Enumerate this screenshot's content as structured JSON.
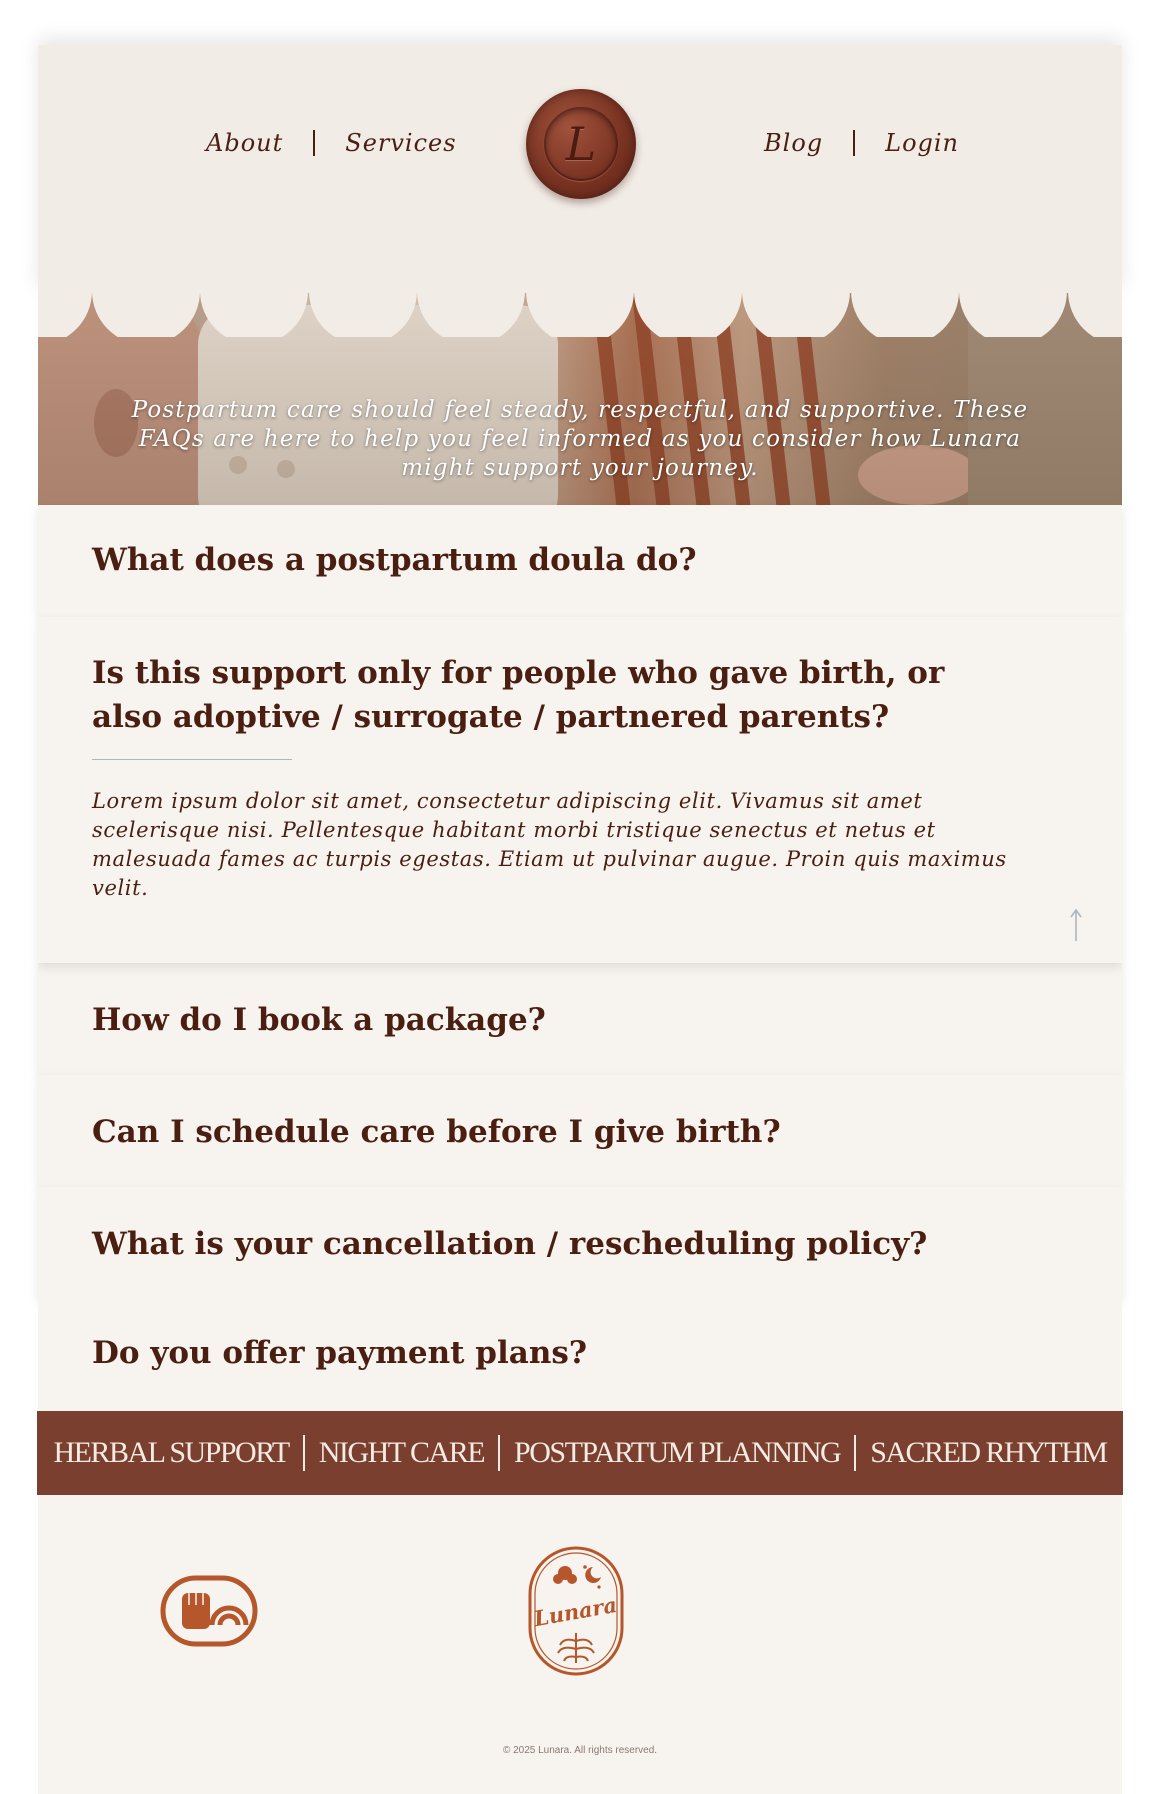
{
  "nav": {
    "left": [
      "About",
      "Services"
    ],
    "right": [
      "Blog",
      "Login"
    ],
    "logo_letter": "L"
  },
  "hero": {
    "text": "Postpartum care should feel steady, respectful, and supportive. These FAQs are here to help you feel informed as you consider how Lunara might support your journey."
  },
  "faqs": [
    {
      "question": "What does a postpartum doula do?"
    },
    {
      "question": "Is this support only for people who gave birth, or also adoptive / surrogate / partnered parents?",
      "answer": "Lorem ipsum dolor sit amet, consectetur adipiscing elit. Vivamus sit amet scelerisque nisi. Pellentesque habitant morbi tristique senectus et netus et malesuada fames ac turpis egestas. Etiam ut pulvinar augue. Proin quis maximus velit."
    },
    {
      "question": "How do I book a package?"
    },
    {
      "question": "Can I schedule care before I give birth?"
    },
    {
      "question": "What is your cancellation / rescheduling policy?"
    },
    {
      "question": "Do you offer payment plans?"
    }
  ],
  "banner": [
    "HERBAL SUPPORT",
    "NIGHT CARE",
    "POSTPARTUM PLANNING",
    "SACRED RHYTHM"
  ],
  "footer": {
    "badge_text": "Lunara",
    "copyright": "© 2025 Lunara. All rights reserved."
  },
  "colors": {
    "brand_brown": "#7a3f2e",
    "text_dark": "#4a1f12",
    "cream": "#f7f3ef",
    "badge_orange": "#b5562b"
  },
  "icons": [
    "wax-seal-logo",
    "arrow-up-icon",
    "raised-fist-rainbow-badge",
    "lunara-floral-badge"
  ]
}
